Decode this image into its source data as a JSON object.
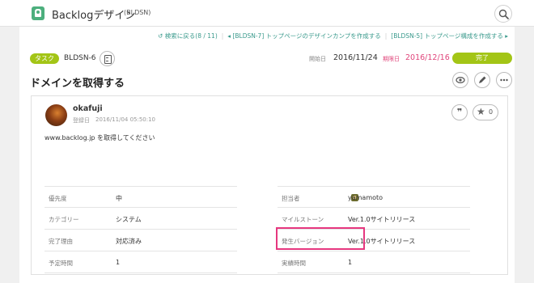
{
  "header": {
    "project_name": "Backlogデザイン",
    "project_key": "(BLDSN)",
    "icons": {
      "project": "backlog-project-icon",
      "search": "search-icon"
    }
  },
  "nav": {
    "back": "検索に戻る(8 / 11)",
    "prev": "[BLDSN-7] トップページのデザインカンプを作成する",
    "next": "[BLDSN-5] トップページ構成を作成する"
  },
  "issue": {
    "type": "タスク",
    "key": "BLDSN-6",
    "start_label": "開始日",
    "start_date": "2016/11/24",
    "due_label": "期限日",
    "due_date": "2016/12/16",
    "status": "完了",
    "title": "ドメインを取得する"
  },
  "comment": {
    "author": "okafuji",
    "registered_label": "登録日",
    "registered_time": "2016/11/04 05:50:10",
    "star_count": "0",
    "description": "www.backlog.jp を取得してください"
  },
  "properties": {
    "left": [
      {
        "label": "優先度",
        "value": "中"
      },
      {
        "label": "カテゴリー",
        "value": "システム"
      },
      {
        "label": "完了理由",
        "value": "対応済み"
      },
      {
        "label": "予定時間",
        "value": "1"
      }
    ],
    "right": [
      {
        "label": "担当者",
        "value": "yamamoto"
      },
      {
        "label": "マイルストーン",
        "value": "Ver.1.0サイトリリース"
      },
      {
        "label": "発生バージョン",
        "value": "Ver.1.0サイトリリース"
      },
      {
        "label": "実績時間",
        "value": "1"
      }
    ]
  },
  "colors": {
    "accent_green": "#a3c516",
    "due_pink": "#e0457b",
    "highlight": "#e6377f",
    "link_teal": "#3a9a8c"
  }
}
